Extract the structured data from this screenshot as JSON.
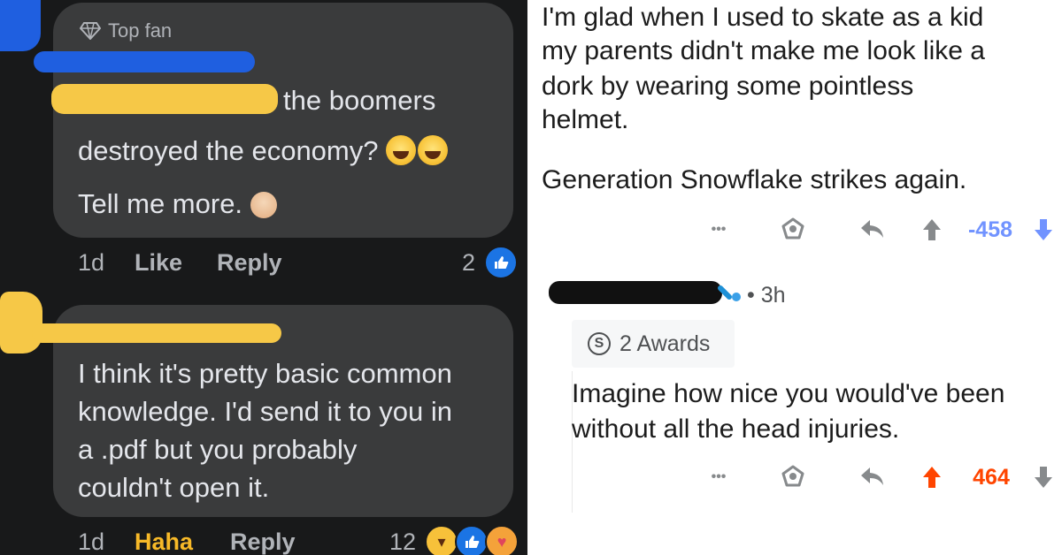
{
  "facebook": {
    "comment_1": {
      "badge": "Top fan",
      "line_1": "the boomers",
      "line_2": "destroyed the economy?",
      "line_3": "Tell me more.",
      "time": "1d",
      "like": "Like",
      "reply": "Reply",
      "reaction_count": "2"
    },
    "comment_2": {
      "line_1": "I think it's pretty basic common",
      "line_2": "knowledge. I'd send it to you in",
      "line_3": "a .pdf but you probably",
      "line_4": "couldn't open it.",
      "time": "1d",
      "haha": "Haha",
      "reply": "Reply",
      "reaction_count": "12"
    }
  },
  "reddit": {
    "post_1": {
      "line_1": "I'm glad when I used to skate as a kid",
      "line_2": "my parents didn't make me look like a",
      "line_3": "dork by wearing some pointless",
      "line_4": "helmet.",
      "line_5": "Generation Snowflake strikes again.",
      "more": "•••",
      "score": "-458"
    },
    "post_2": {
      "time": "• 3h",
      "awards": "2 Awards",
      "line_1": "Imagine how nice you would've been",
      "line_2": "without all the head injuries.",
      "more": "•••",
      "score": "464"
    }
  },
  "colors": {
    "fb_background": "#18191a",
    "fb_bubble": "#3a3b3c",
    "fb_like_blue": "#1b74e4",
    "fb_haha_yellow": "#f7c13a",
    "redaction_blue": "#1f5fe0",
    "redaction_yellow": "#f6c847",
    "redaction_black": "#111111",
    "reddit_downvote": "#7193ff",
    "reddit_upvote": "#ff4500"
  }
}
